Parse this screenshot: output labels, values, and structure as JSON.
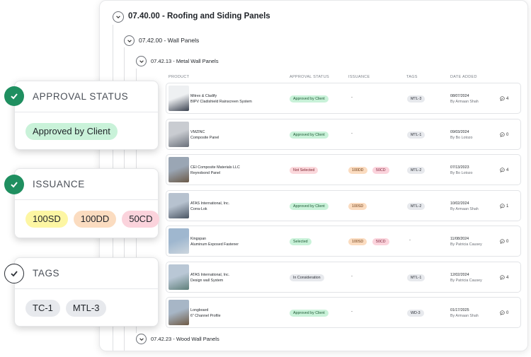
{
  "sections": {
    "level1": "07.40.00 - Roofing and Siding Panels",
    "level2": "07.42.00 - Wall Panels",
    "level3": "07.42.13 - Metal Wall Panels",
    "level3b": "07.42.23 - Wood Wall Panels"
  },
  "columns": {
    "product": "PRODUCT",
    "approval": "APPROVAL STATUS",
    "issuance": "ISSUANCE",
    "tags": "TAGS",
    "date": "DATE ADDED"
  },
  "rows": [
    {
      "manufacturer": "Mitrex & Cladify",
      "product": "BIPV Cladishield Rainscreen System",
      "approval": "Approved by Client",
      "approval_color": "green",
      "issuance": [],
      "tag": "MTL-3",
      "date": "08/07/2024",
      "by": "By Armaan Shah",
      "comments": "4"
    },
    {
      "manufacturer": "VMZINC",
      "product": "Composite Panel",
      "approval": "Approved by Client",
      "approval_color": "green",
      "issuance": [],
      "tag": "MTL-1",
      "date": "09/03/2024",
      "by": "By Bo Lotozo",
      "comments": "0"
    },
    {
      "manufacturer": "CEI Composite Materials LLC",
      "product": "Reynobond Panel",
      "approval": "Not Selected",
      "approval_color": "red",
      "issuance": [
        "100DD",
        "50CD"
      ],
      "tag": "MTL-2",
      "date": "07/13/2023",
      "by": "By Bo Lotozo",
      "comments": "4"
    },
    {
      "manufacturer": "ATAS International, Inc.",
      "product": "Corra-Lok",
      "approval": "Approved by Client",
      "approval_color": "green",
      "issuance": [
        "100SD"
      ],
      "tag": "MTL-2",
      "date": "10/02/2024",
      "by": "By Armaan Shah",
      "comments": "1"
    },
    {
      "manufacturer": "Kingspan",
      "product": "Aluminum Exposed Fastener",
      "approval": "Selected",
      "approval_color": "green",
      "issuance": [
        "100SD",
        "50CD"
      ],
      "tag": "",
      "date": "11/08/2024",
      "by": "By Patricia Causey",
      "comments": "0"
    },
    {
      "manufacturer": "ATAS International, Inc.",
      "product": "Design wall System",
      "approval": "In Consideration",
      "approval_color": "gray",
      "issuance": [],
      "tag": "MTL-1",
      "date": "12/02/2024",
      "by": "By Patricia Causey",
      "comments": "4"
    },
    {
      "manufacturer": "Longboard",
      "product": "6\" Channel Profile",
      "approval": "Approved by Client",
      "approval_color": "green",
      "issuance": [],
      "tag": "WD-3",
      "date": "01/17/2025",
      "by": "By Armaan Shah",
      "comments": "0"
    }
  ],
  "dash": "-",
  "cards": {
    "approval": {
      "title": "APPROVAL STATUS",
      "value": "Approved by Client"
    },
    "issuance": {
      "title": "ISSUANCE",
      "values": [
        "100SD",
        "100DD",
        "50CD"
      ]
    },
    "tags": {
      "title": "TAGS",
      "values": [
        "TC-1",
        "MTL-3"
      ]
    }
  },
  "colors": {
    "green": "#c9f2d9",
    "red": "#fbd8dc",
    "orange": "#fbdcc0",
    "pink": "#fbd3dc",
    "yellow": "#fdf6a3",
    "gray": "#e7e9ed",
    "check": "#1f8f60"
  }
}
